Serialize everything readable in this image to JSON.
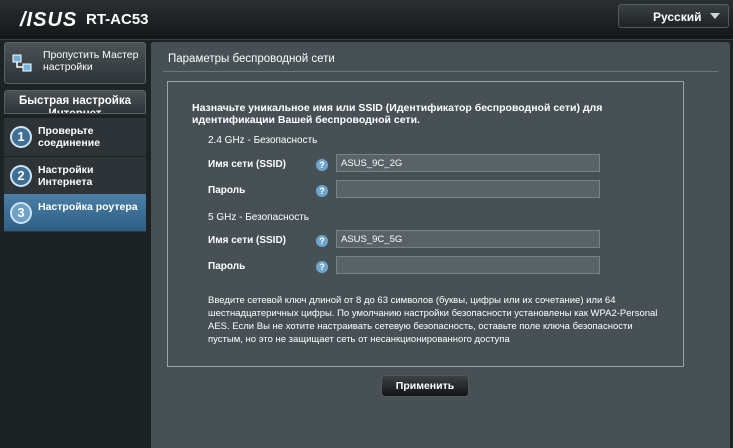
{
  "header": {
    "logo": "/ISUS",
    "model": "RT-AC53",
    "language": "Русский"
  },
  "sidebar": {
    "skip_label": "Пропустить Мастер настройки",
    "quick_setup_title": "Быстрая настройка Интернет",
    "steps": [
      {
        "num": "1",
        "label": "Проверьте соединение"
      },
      {
        "num": "2",
        "label": "Настройки Интернета"
      },
      {
        "num": "3",
        "label": "Настройка роутера"
      }
    ]
  },
  "main": {
    "title": "Параметры беспроводной сети",
    "intro": "Назначьте уникальное имя или SSID (Идентификатор беспроводной сети) для идентификации Вашей беспроводной сети.",
    "band24": {
      "title": "2.4 GHz - Безопасность",
      "ssid_label": "Имя сети (SSID)",
      "ssid_value": "ASUS_9C_2G",
      "password_label": "Пароль",
      "password_value": ""
    },
    "band5": {
      "title": "5 GHz - Безопасность",
      "ssid_label": "Имя сети (SSID)",
      "ssid_value": "ASUS_9C_5G",
      "password_label": "Пароль",
      "password_value": ""
    },
    "help_glyph": "?",
    "note": "Введите сетевой ключ длиной от 8 до 63 символов (буквы, цифры или их сочетание) или 64 шестнадцатеричных цифры. По умолчанию настройки безопасности установлены как WPA2-Personal AES. Если Вы не хотите настраивать сетевую безопасность, оставьте поле ключа безопасности пустым, но это не защищает сеть от несанкционированного доступа",
    "apply_label": "Применить"
  }
}
